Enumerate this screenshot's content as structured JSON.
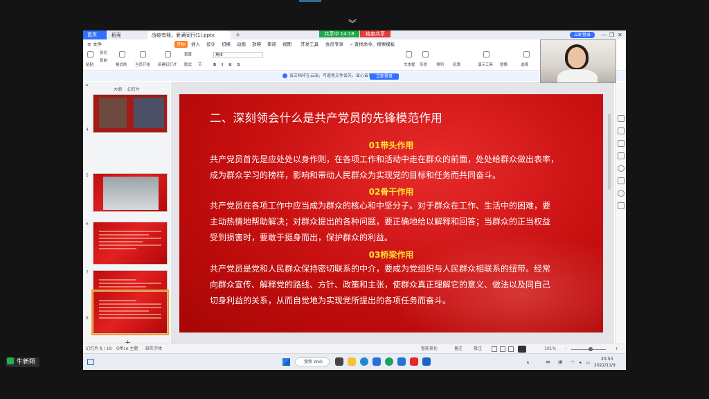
{
  "meeting": {
    "collapse_chevron": "︾",
    "speaker_name": "牛新翔"
  },
  "wps": {
    "tabs": {
      "home": "首页",
      "docer": "稻壳",
      "doc": "战疫有我，爱满同行(1).pptx",
      "add": "+"
    },
    "share_status": "共享中 14:18",
    "stop_share": "结束共享",
    "login": "立即登录",
    "window_controls": [
      "—",
      "❐",
      "✕"
    ],
    "menu": {
      "file": "文件",
      "items": [
        "开始",
        "插入",
        "设计",
        "切换",
        "动画",
        "放映",
        "审阅",
        "视图",
        "开发工具",
        "会员专享"
      ],
      "search": "查找命令、搜索模板"
    },
    "ribbon": {
      "labels": [
        "粘贴",
        "剪切",
        "复制",
        "格式刷",
        "当页开始",
        "新建幻灯片",
        "版式",
        "节",
        "重置",
        "文本框",
        "形状",
        "排列",
        "轮廓",
        "演示工具",
        "替换",
        "选择"
      ],
      "font_name": "黑体"
    },
    "notice": {
      "text": "该文档将在云端，可避免文件丢失，省心省事",
      "button": "立即登录"
    },
    "left_panel": {
      "tab_outline": "大纲",
      "tab_slides": "幻灯片",
      "slide_numbers": [
        "4",
        "5",
        "6",
        "7",
        "8"
      ],
      "add": "+"
    },
    "slide": {
      "title": "二、深刻领会什么是共产党员的先锋模范作用",
      "sections": [
        {
          "heading": "01带头作用",
          "lines": [
            "共产党员首先是应处处以身作则，在各项工作和活动中走在群众的前面，处处给群众做出表率，",
            "成为群众学习的榜样，影响和带动人民群众为实现党的目标和任务而共同奋斗。"
          ]
        },
        {
          "heading": "02骨干作用",
          "lines": [
            "共产党员在各项工作中应当成为群众的核心和中坚分子。对于群众在工作、生活中的困难，要",
            "主动热情地帮助解决；对群众提出的各种问题，要正确地给以解释和回答；当群众的正当权益",
            "受到损害时，要敢于挺身而出，保护群众的利益。"
          ]
        },
        {
          "heading": "03桥梁作用",
          "lines": [
            "共产党员是党和人民群众保持密切联系的中介，要成为党组织与人民群众相联系的纽带。经常",
            "向群众宣传、解释党的路线、方针、政策和主张，使群众真正理解它的意义、做法以及同自己",
            "切身利益的关系，从而自觉地为实现党所提出的各项任务而奋斗。"
          ]
        }
      ]
    },
    "status": {
      "slide_counter": "幻灯片 8 / 18",
      "theme": "Office 主题",
      "spell": "缺失字体",
      "smart": "智能美化",
      "notes": "备注",
      "comment": "批注",
      "zoom": "101%",
      "zoom_minus": "-",
      "zoom_plus": "+"
    }
  },
  "taskbar": {
    "search": "搜索 Web",
    "tray": [
      "∧",
      "中",
      "拼"
    ],
    "time": "20:50",
    "date": "2022/11/9"
  },
  "colors": {
    "slide_red": "#c81010",
    "heading_yellow": "#ffe332",
    "wps_blue": "#3370ff",
    "share_green": "#21a849",
    "stop_red": "#e23c3c"
  }
}
